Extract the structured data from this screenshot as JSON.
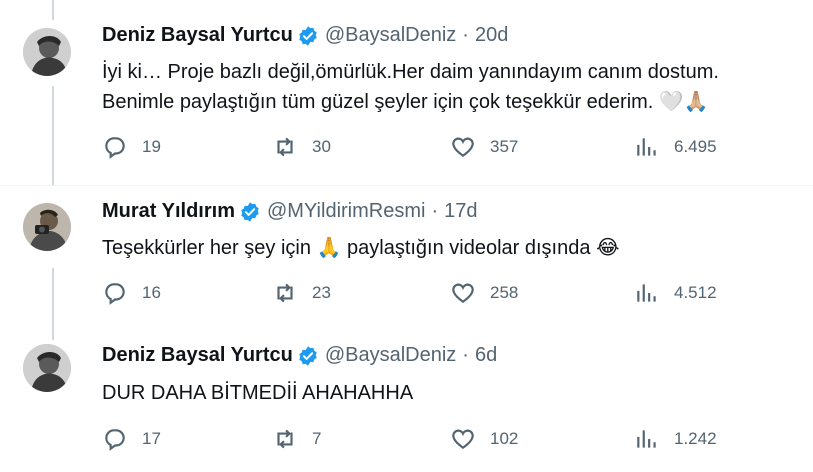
{
  "colors": {
    "text": "#0f1419",
    "secondary": "#536471",
    "verified": "#1d9bf0",
    "thread_line": "#cfd9de"
  },
  "tweets": [
    {
      "name": "Deniz Baysal Yurtcu",
      "handle": "@BaysalDeniz",
      "separator": "·",
      "time": "20d",
      "line1": "İyi ki… Proje bazlı değil,ömürlük.Her daim yanındayım canım dostum.",
      "line2": "Benimle paylaştığın tüm güzel şeyler için çok teşekkür ederim.",
      "emoji": "🤍🙏🏼",
      "replies": "19",
      "retweets": "30",
      "likes": "357",
      "views": "6.495"
    },
    {
      "name": "Murat Yıldırım",
      "handle": "@MYildirimResmi",
      "separator": "·",
      "time": "17d",
      "line1_a": "Teşekkürler her şey için",
      "emoji_a": "🙏",
      "line1_b": "paylaştığın videolar dışında",
      "emoji_b": "😂",
      "replies": "16",
      "retweets": "23",
      "likes": "258",
      "views": "4.512"
    },
    {
      "name": "Deniz Baysal Yurtcu",
      "handle": "@BaysalDeniz",
      "separator": "·",
      "time": "6d",
      "line1": "DUR DAHA BİTMEDİİ AHAHAHHA",
      "replies": "17",
      "retweets": "7",
      "likes": "102",
      "views": "1.242"
    }
  ],
  "icons": {
    "reply": "reply-icon",
    "retweet": "retweet-icon",
    "like": "heart-icon",
    "views": "views-icon",
    "verified": "verified-badge-icon"
  }
}
